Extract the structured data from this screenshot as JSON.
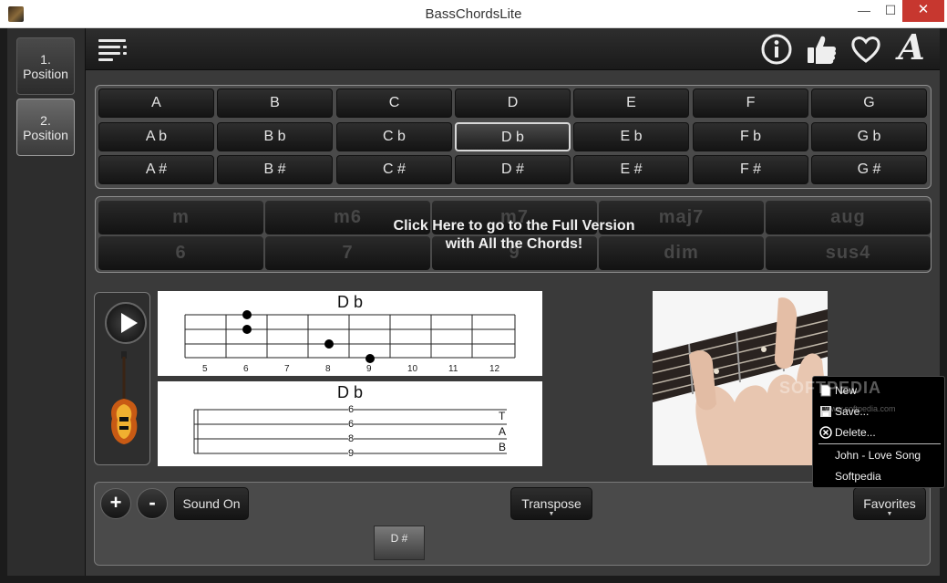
{
  "window": {
    "title": "BassChordsLite",
    "controls": [
      "—",
      "☐",
      "✕"
    ]
  },
  "sidebar": {
    "positions": [
      {
        "number": "1.",
        "label": "Position"
      },
      {
        "number": "2.",
        "label": "Position"
      }
    ]
  },
  "header": {
    "icons": [
      "menu-icon",
      "info-icon",
      "thumbs-up-icon",
      "heart-icon",
      "font-icon"
    ],
    "font_glyph": "A"
  },
  "chords": {
    "rows": [
      [
        "A",
        "B",
        "C",
        "D",
        "E",
        "F",
        "G"
      ],
      [
        "A b",
        "B b",
        "C b",
        "D b",
        "E b",
        "F b",
        "G b"
      ],
      [
        "A #",
        "B #",
        "C #",
        "D #",
        "E #",
        "F #",
        "G #"
      ]
    ],
    "selected": "D b"
  },
  "chord_types": {
    "row1": [
      "m",
      "m6",
      "m7",
      "maj7",
      "aug"
    ],
    "row2": [
      "6",
      "7",
      "9",
      "dim",
      "sus4"
    ],
    "overlay_line1": "Click Here to go to the Full Version",
    "overlay_line2": "with All the Chords!"
  },
  "fretboard": {
    "title": "D b",
    "fret_numbers": [
      "5",
      "6",
      "7",
      "8",
      "9",
      "10",
      "11",
      "12"
    ]
  },
  "tablature": {
    "title": "D b",
    "notes": [
      "6",
      "6",
      "8",
      "9"
    ],
    "tab_letters": [
      "T",
      "A",
      "B"
    ]
  },
  "bottom": {
    "plus_label": "+",
    "minus_label": "-",
    "sound_label": "Sound On",
    "transpose_label": "Transpose",
    "favorites_label": "Favorites",
    "favorite_chip": "D #"
  },
  "popup_menu": {
    "items": [
      "New",
      "Save...",
      "Delete..."
    ],
    "favorites": [
      "John - Love Song",
      "Softpedia"
    ]
  },
  "watermark": {
    "text": "SOFTPEDIA",
    "sub": "www.softpedia.com"
  },
  "colors": {
    "background": "#3a3a3a",
    "titlebar": "#ffffff",
    "close_button": "#c7372f",
    "selected_border": "#d8d8d8"
  }
}
